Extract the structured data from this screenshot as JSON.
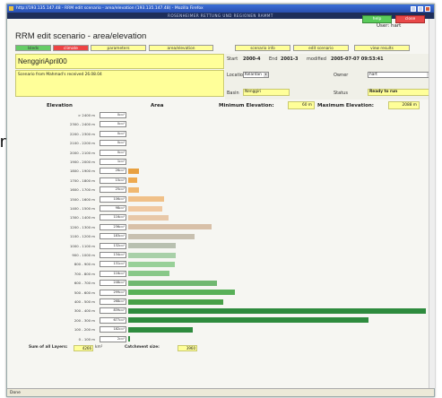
{
  "browser": {
    "title": "http://193.135.147.48 - RRM edit scenario - area/elevation (193.135.147.48) - Mozilla Firefox",
    "status": "Done"
  },
  "header": {
    "ribbon": "ROSENHEIMER RETTUNG UND REGIONEN RAMMT",
    "help_label": "help",
    "close_label": "close",
    "user": "User: hart"
  },
  "page_title": "RRM edit scenario - area/elevation",
  "tabs": [
    {
      "label": "lsleds",
      "color": "#66cc66"
    },
    {
      "label": "climate",
      "color": "#ee4444"
    },
    {
      "label": "parameters",
      "color": "#ffff99"
    },
    {
      "label": "area/elevation",
      "color": "#ffff99"
    }
  ],
  "right_tabs": [
    {
      "label": "scenario info"
    },
    {
      "label": "edit scenario"
    },
    {
      "label": "view results"
    }
  ],
  "scenario": {
    "name": "NenggiriApril00",
    "description": "Scenario from Mahmad's received 26.08.04"
  },
  "info": {
    "start_label": "Start",
    "start": "2000-4",
    "end_label": "End",
    "end": "2001-3",
    "modified_label": "modified",
    "modified": "2005-07-07 09:53:41",
    "location_label": "Location",
    "location": "Kelantan",
    "owner_label": "Owner",
    "owner": "hart",
    "basin_label": "Basin",
    "basin": "Nenggiri",
    "status_label": "Status",
    "status": "Ready to run"
  },
  "table": {
    "elevation_header": "Elevation",
    "area_header": "Area",
    "min_label": "Minimum Elevation:",
    "min_value": "60 m",
    "max_label": "Maximum Elevation:",
    "max_value": "2088 m",
    "rows": [
      {
        "label": "> 2400 m",
        "value": "0",
        "bar": 0,
        "color": "#e8a040"
      },
      {
        "label": "2300 - 2400 m",
        "value": "0",
        "bar": 0,
        "color": "#e8a040"
      },
      {
        "label": "2200 - 2300 m",
        "value": "0",
        "bar": 0,
        "color": "#e8a040"
      },
      {
        "label": "2100 - 2200 m",
        "value": "0",
        "bar": 0,
        "color": "#e8a040"
      },
      {
        "label": "2000 - 2100 m",
        "value": "0",
        "bar": 0,
        "color": "#e8a040"
      },
      {
        "label": "1900 - 2000 m",
        "value": "1",
        "bar": 0,
        "color": "#e8a040"
      },
      {
        "label": "1800 - 1900 m",
        "value": "26",
        "bar": 12,
        "color": "#e8a040"
      },
      {
        "label": "1700 - 1800 m",
        "value": "15",
        "bar": 10,
        "color": "#eeaa50"
      },
      {
        "label": "1600 - 1700 m",
        "value": "25",
        "bar": 12,
        "color": "#f0b870"
      },
      {
        "label": "1500 - 1600 m",
        "value": "106",
        "bar": 40,
        "color": "#f0c088"
      },
      {
        "label": "1400 - 1500 m",
        "value": "98",
        "bar": 38,
        "color": "#f0c8a0"
      },
      {
        "label": "1300 - 1400 m",
        "value": "116",
        "bar": 45,
        "color": "#e8c8a8"
      },
      {
        "label": "1200 - 1300 m",
        "value": "236",
        "bar": 93,
        "color": "#d8c0a8"
      },
      {
        "label": "1100 - 1200 m",
        "value": "183",
        "bar": 74,
        "color": "#c8c0b0"
      },
      {
        "label": "1000 - 1100 m",
        "value": "132",
        "bar": 53,
        "color": "#b8c0b0"
      },
      {
        "label": "900 - 1000 m",
        "value": "134",
        "bar": 53,
        "color": "#a8d0a8"
      },
      {
        "label": "800 - 900 m",
        "value": "131",
        "bar": 52,
        "color": "#98d098"
      },
      {
        "label": "700 - 800 m",
        "value": "116",
        "bar": 46,
        "color": "#88c888"
      },
      {
        "label": "600 - 700 m",
        "value": "248",
        "bar": 99,
        "color": "#70b870"
      },
      {
        "label": "500 - 600 m",
        "value": "299",
        "bar": 119,
        "color": "#58b058"
      },
      {
        "label": "400 - 500 m",
        "value": "268",
        "bar": 106,
        "color": "#48a048"
      },
      {
        "label": "300 - 400 m",
        "value": "839",
        "bar": 332,
        "color": "#2e8b3e"
      },
      {
        "label": "200 - 300 m",
        "value": "677",
        "bar": 268,
        "color": "#2e8b3e"
      },
      {
        "label": "100 - 200 m",
        "value": "182",
        "bar": 72,
        "color": "#2e8b3e"
      },
      {
        "label": "0 - 100 m",
        "value": "2",
        "bar": 2,
        "color": "#2e8b3e"
      }
    ],
    "unit": "km²",
    "sum_label": "Sum of all Layers:",
    "sum_value": "4266",
    "catchment_label": "Catchment size:",
    "catchment_value": "3960"
  }
}
